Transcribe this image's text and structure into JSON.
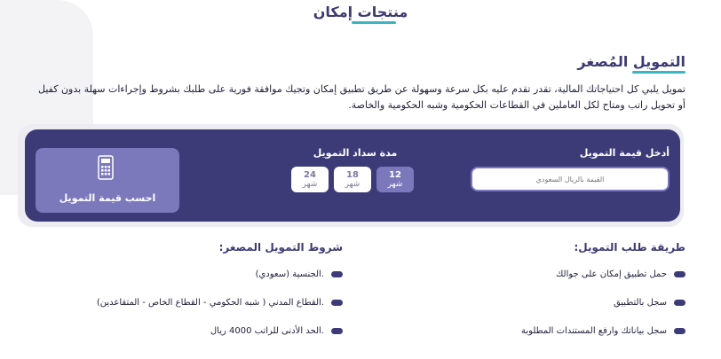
{
  "page_title": "منتجات إمكان",
  "section": {
    "title": "التمويل المُصغر",
    "description": "تمويل يلبي كل احتياجاتك المالية، تقدر تقدم عليه بكل سرعة وسهولة عن طريق تطبيق إمكان وتجيك موافقة فورية على طلبك بشروط وإجراءات سهلة بدون كفيل أو تحويل راتب ومتاح لكل العاملين في القطاعات الحكومية وشبه الحكومية والخاصة."
  },
  "calculator": {
    "amount_label": "أدخل قيمة التمويل",
    "amount_placeholder": "القيمة بالريال السعودي",
    "duration_label": "مدة سداد التمويل",
    "durations": [
      {
        "value": "12",
        "unit": "شهر",
        "selected": true
      },
      {
        "value": "18",
        "unit": "شهر",
        "selected": false
      },
      {
        "value": "24",
        "unit": "شهر",
        "selected": false
      }
    ],
    "button_label": "احسب قيمة التمويل",
    "button_icon": "calculator-icon"
  },
  "application_steps": {
    "title": "طريقة طلب التمويل:",
    "items": [
      "حمل تطبيق إمكان على جوالك",
      "سجل بالتطبيق",
      "سجل بياناتك وارفع المستندات المطلوبة"
    ]
  },
  "conditions": {
    "title": "شروط التمويل المصغر:",
    "items": [
      ".الجنسية (سعودي)",
      ".القطاع المدني ( شبه الحكومي - القطاع الخاص - المتقاعدين)",
      ".الحد الأدنى للراتب 4000 ريال"
    ]
  },
  "colors": {
    "primary": "#3c3b78",
    "accent": "#3ab5c4",
    "selected": "#7c78bc"
  }
}
